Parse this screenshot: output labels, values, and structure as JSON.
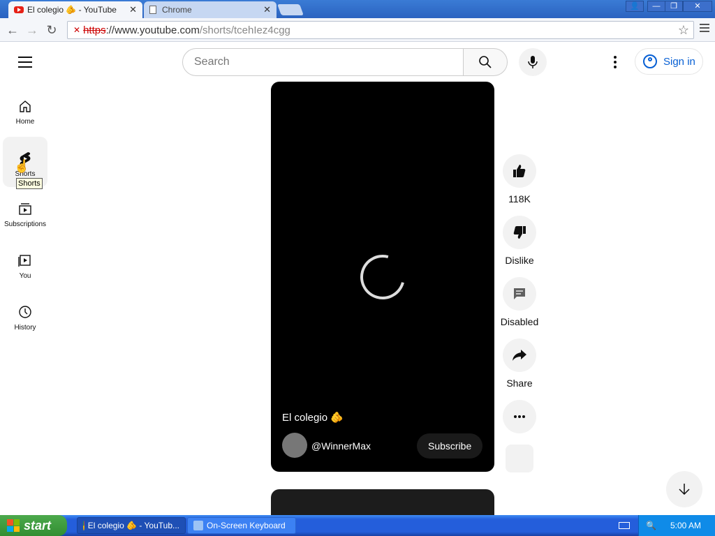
{
  "browser": {
    "tabs": [
      {
        "title": "El colegio 🫵 - YouTube",
        "active": true
      },
      {
        "title": "Chrome",
        "active": false
      }
    ],
    "url": {
      "scheme": "https",
      "host": "://www.youtube.com",
      "path": "/shorts/tcehIez4cgg"
    }
  },
  "masthead": {
    "search_placeholder": "Search",
    "sign_in_label": "Sign in"
  },
  "guide": {
    "items": [
      {
        "label": "Home",
        "icon": "home-icon"
      },
      {
        "label": "Shorts",
        "icon": "shorts-icon"
      },
      {
        "label": "Subscriptions",
        "icon": "subscriptions-icon"
      },
      {
        "label": "You",
        "icon": "you-icon"
      },
      {
        "label": "History",
        "icon": "history-icon"
      }
    ],
    "tooltip": "Shorts"
  },
  "short": {
    "title": "El colegio 🫵",
    "channel": "@WinnerMax",
    "subscribe_label": "Subscribe"
  },
  "actions": {
    "like_count": "118K",
    "dislike_label": "Dislike",
    "comments_label": "Disabled",
    "share_label": "Share"
  },
  "taskbar": {
    "start_label": "start",
    "tasks": [
      {
        "label": "El colegio 🫵 - YouTub..."
      },
      {
        "label": "On-Screen Keyboard"
      }
    ],
    "clock": "5:00 AM"
  },
  "colors": {
    "accent": "#065fd4",
    "player_bg": "#000000",
    "button_bg": "#f2f2f2"
  }
}
